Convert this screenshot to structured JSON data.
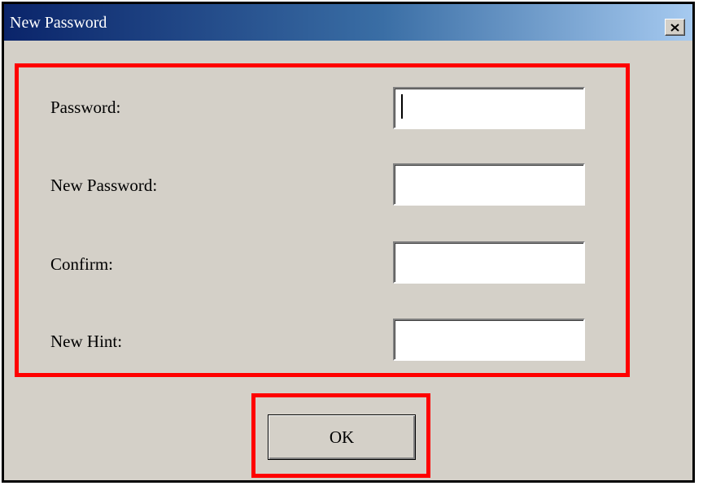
{
  "window": {
    "title": "New Password"
  },
  "form": {
    "fields": [
      {
        "label": "Password:",
        "value": ""
      },
      {
        "label": "New Password:",
        "value": ""
      },
      {
        "label": "Confirm:",
        "value": ""
      },
      {
        "label": "New Hint:",
        "value": ""
      }
    ]
  },
  "buttons": {
    "ok_label": "OK"
  },
  "icons": {
    "close": "close-icon"
  },
  "colors": {
    "highlight": "#ff0000",
    "dialog_bg": "#d4d0c8",
    "titlebar_start": "#0a246a",
    "titlebar_end": "#a6caf0"
  }
}
